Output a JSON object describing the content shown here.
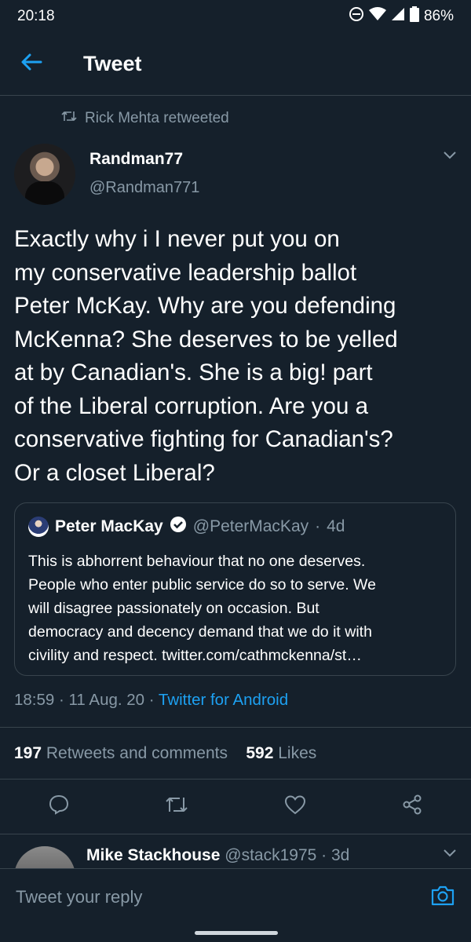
{
  "status_bar": {
    "time": "20:18",
    "battery": "86%"
  },
  "header": {
    "title": "Tweet",
    "back_icon": "back-arrow-icon"
  },
  "retweet_context": {
    "label": "Rick Mehta retweeted",
    "icon": "retweet-icon"
  },
  "tweet": {
    "author_name": "Randman77",
    "author_handle": "@Randman771",
    "text": "Exactly why i I never put you on\nmy conservative leadership ballot\nPeter McKay. Why are you defending\nMcKenna? She deserves to be yelled\nat by Canadian's. She is a big! part\nof the Liberal corruption. Are you a\nconservative fighting for Canadian's?\nOr a closet Liberal?",
    "time": "18:59",
    "date": "11 Aug. 20",
    "source": "Twitter for Android",
    "retweets_count": "197",
    "retweets_label": "Retweets and comments",
    "likes_count": "592",
    "likes_label": "Likes"
  },
  "quoted_tweet": {
    "name": "Peter MacKay",
    "handle": "@PeterMacKay",
    "age": "4d",
    "text": "This is abhorrent behaviour that no one deserves.\nPeople who enter public service do so to serve. We\nwill disagree passionately on occasion. But\ndemocracy and decency demand that we do it with\ncivility and respect. twitter.com/cathmckenna/st…"
  },
  "reply_preview": {
    "name": "Mike Stackhouse",
    "handle": "@stack1975",
    "age": "3d"
  },
  "reply_bar": {
    "placeholder": "Tweet your reply"
  },
  "colors": {
    "background": "#15202b",
    "accent": "#1da1f2",
    "secondary_text": "#8899a6",
    "divider": "#38444d"
  }
}
